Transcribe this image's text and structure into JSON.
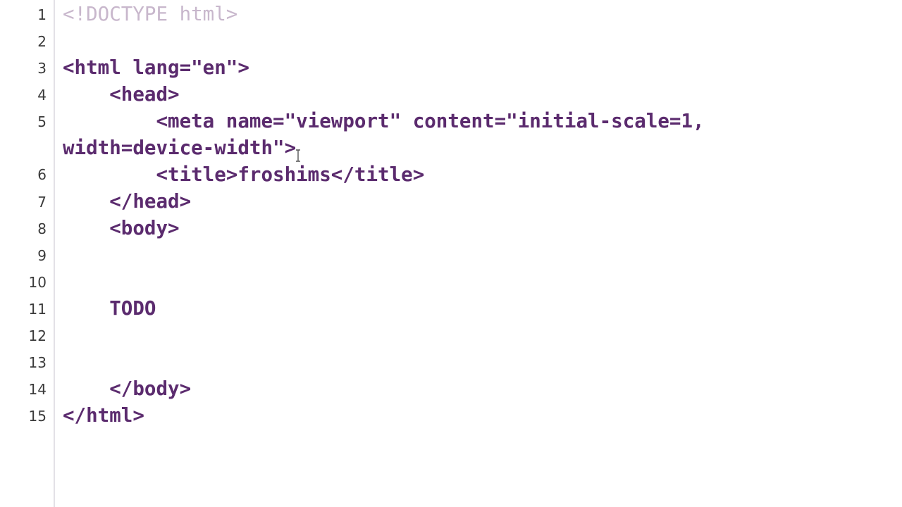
{
  "editor": {
    "line_numbers": [
      "1",
      "2",
      "3",
      "4",
      "5",
      "6",
      "7",
      "8",
      "9",
      "10",
      "11",
      "12",
      "13",
      "14",
      "15"
    ],
    "code_lines": {
      "l1": "<!DOCTYPE html>",
      "l3": "<html lang=\"en\">",
      "l4": "    <head>",
      "l5a": "        <meta name=\"viewport\" content=\"initial-scale=1,",
      "l5b": "width=device-width\">",
      "l6": "        <title>froshims</title>",
      "l7": "    </head>",
      "l8": "    <body>",
      "l11": "    TODO",
      "l14": "    </body>",
      "l15": "</html>"
    },
    "colors": {
      "text": "#5b2b6e",
      "doctype": "#c8b7cc",
      "line_numbers": "#3a3a3a",
      "gutter_divider": "#e3e1e7"
    },
    "cursor_icon": "text-cursor-icon"
  }
}
